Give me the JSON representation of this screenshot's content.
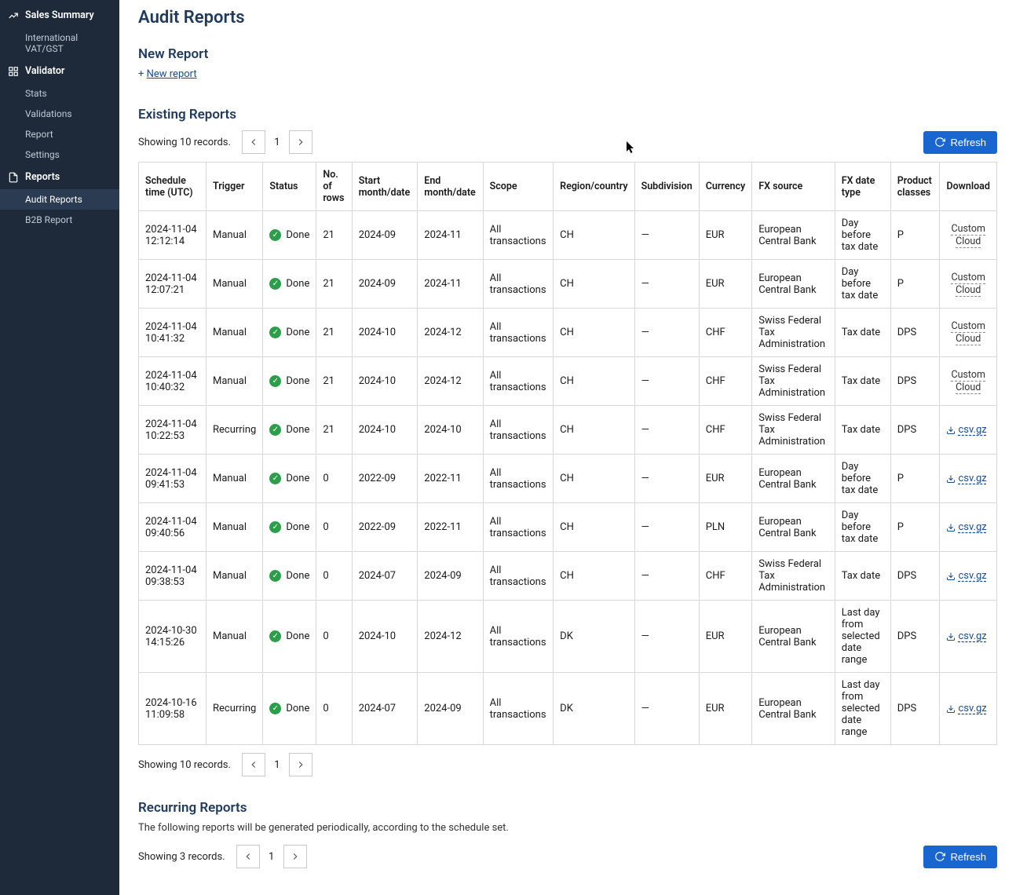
{
  "page": {
    "title": "Audit Reports"
  },
  "sidebar": {
    "sections": [
      {
        "label": "Sales Summary",
        "icon": "chart-line-icon",
        "subs": [
          {
            "label": "International VAT/GST",
            "active": false
          }
        ]
      },
      {
        "label": "Validator",
        "icon": "grid-icon",
        "subs": [
          {
            "label": "Stats",
            "active": false
          },
          {
            "label": "Validations",
            "active": false
          },
          {
            "label": "Report",
            "active": false
          },
          {
            "label": "Settings",
            "active": false
          }
        ]
      },
      {
        "label": "Reports",
        "icon": "reports-icon",
        "subs": [
          {
            "label": "Audit Reports",
            "active": true
          },
          {
            "label": "B2B Report",
            "active": false
          }
        ]
      }
    ]
  },
  "sections": {
    "new_report": {
      "title": "New Report",
      "link_prefix": "+ ",
      "link_text": "New report"
    },
    "existing": {
      "title": "Existing Reports",
      "records_label": "Showing 10 records.",
      "page_num": "1",
      "refresh_label": "Refresh"
    },
    "recurring": {
      "title": "Recurring Reports",
      "description": "The following reports will be generated periodically, according to the schedule set.",
      "records_label": "Showing 3 records.",
      "page_num": "1",
      "refresh_label": "Refresh"
    }
  },
  "table": {
    "headers": {
      "schedule": "Schedule time (UTC)",
      "trigger": "Trigger",
      "status": "Status",
      "rows": "No. of rows",
      "start": "Start month/date",
      "end": "End month/date",
      "scope": "Scope",
      "region": "Region/country",
      "subdivision": "Subdivision",
      "currency": "Currency",
      "fx_source": "FX source",
      "fx_date_type": "FX date type",
      "product": "Product classes",
      "download": "Download"
    },
    "rows": [
      {
        "schedule": "2024-11-04 12:12:14",
        "trigger": "Manual",
        "status": "Done",
        "rows": "21",
        "start": "2024-09",
        "end": "2024-11",
        "scope": "All transactions",
        "region": "CH",
        "subdivision": "—",
        "currency": "EUR",
        "fx_source": "European Central Bank",
        "fx_date_type": "Day before tax date",
        "product": "P",
        "download": {
          "type": "custom",
          "label": "Custom Cloud"
        }
      },
      {
        "schedule": "2024-11-04 12:07:21",
        "trigger": "Manual",
        "status": "Done",
        "rows": "21",
        "start": "2024-09",
        "end": "2024-11",
        "scope": "All transactions",
        "region": "CH",
        "subdivision": "—",
        "currency": "EUR",
        "fx_source": "European Central Bank",
        "fx_date_type": "Day before tax date",
        "product": "P",
        "download": {
          "type": "custom",
          "label": "Custom Cloud"
        }
      },
      {
        "schedule": "2024-11-04 10:41:32",
        "trigger": "Manual",
        "status": "Done",
        "rows": "21",
        "start": "2024-10",
        "end": "2024-12",
        "scope": "All transactions",
        "region": "CH",
        "subdivision": "—",
        "currency": "CHF",
        "fx_source": "Swiss Federal Tax Administration",
        "fx_date_type": "Tax date",
        "product": "DPS",
        "download": {
          "type": "custom",
          "label": "Custom Cloud"
        }
      },
      {
        "schedule": "2024-11-04 10:40:32",
        "trigger": "Manual",
        "status": "Done",
        "rows": "21",
        "start": "2024-10",
        "end": "2024-12",
        "scope": "All transactions",
        "region": "CH",
        "subdivision": "—",
        "currency": "CHF",
        "fx_source": "Swiss Federal Tax Administration",
        "fx_date_type": "Tax date",
        "product": "DPS",
        "download": {
          "type": "custom",
          "label": "Custom Cloud"
        }
      },
      {
        "schedule": "2024-11-04 10:22:53",
        "trigger": "Recurring",
        "status": "Done",
        "rows": "21",
        "start": "2024-10",
        "end": "2024-10",
        "scope": "All transactions",
        "region": "CH",
        "subdivision": "—",
        "currency": "CHF",
        "fx_source": "Swiss Federal Tax Administration",
        "fx_date_type": "Tax date",
        "product": "DPS",
        "download": {
          "type": "csv",
          "label": "csv.gz"
        }
      },
      {
        "schedule": "2024-11-04 09:41:53",
        "trigger": "Manual",
        "status": "Done",
        "rows": "0",
        "start": "2022-09",
        "end": "2022-11",
        "scope": "All transactions",
        "region": "CH",
        "subdivision": "—",
        "currency": "EUR",
        "fx_source": "European Central Bank",
        "fx_date_type": "Day before tax date",
        "product": "P",
        "download": {
          "type": "csv",
          "label": "csv.gz"
        }
      },
      {
        "schedule": "2024-11-04 09:40:56",
        "trigger": "Manual",
        "status": "Done",
        "rows": "0",
        "start": "2022-09",
        "end": "2022-11",
        "scope": "All transactions",
        "region": "CH",
        "subdivision": "—",
        "currency": "PLN",
        "fx_source": "European Central Bank",
        "fx_date_type": "Day before tax date",
        "product": "P",
        "download": {
          "type": "csv",
          "label": "csv.gz"
        }
      },
      {
        "schedule": "2024-11-04 09:38:53",
        "trigger": "Manual",
        "status": "Done",
        "rows": "0",
        "start": "2024-07",
        "end": "2024-09",
        "scope": "All transactions",
        "region": "CH",
        "subdivision": "—",
        "currency": "CHF",
        "fx_source": "Swiss Federal Tax Administration",
        "fx_date_type": "Tax date",
        "product": "DPS",
        "download": {
          "type": "csv",
          "label": "csv.gz"
        }
      },
      {
        "schedule": "2024-10-30 14:15:26",
        "trigger": "Manual",
        "status": "Done",
        "rows": "0",
        "start": "2024-10",
        "end": "2024-12",
        "scope": "All transactions",
        "region": "DK",
        "subdivision": "—",
        "currency": "EUR",
        "fx_source": "European Central Bank",
        "fx_date_type": "Last day from selected date range",
        "product": "DPS",
        "download": {
          "type": "csv",
          "label": "csv.gz"
        }
      },
      {
        "schedule": "2024-10-16 11:09:58",
        "trigger": "Recurring",
        "status": "Done",
        "rows": "0",
        "start": "2024-07",
        "end": "2024-09",
        "scope": "All transactions",
        "region": "DK",
        "subdivision": "—",
        "currency": "EUR",
        "fx_source": "European Central Bank",
        "fx_date_type": "Last day from selected date range",
        "product": "DPS",
        "download": {
          "type": "csv",
          "label": "csv.gz"
        }
      }
    ]
  }
}
